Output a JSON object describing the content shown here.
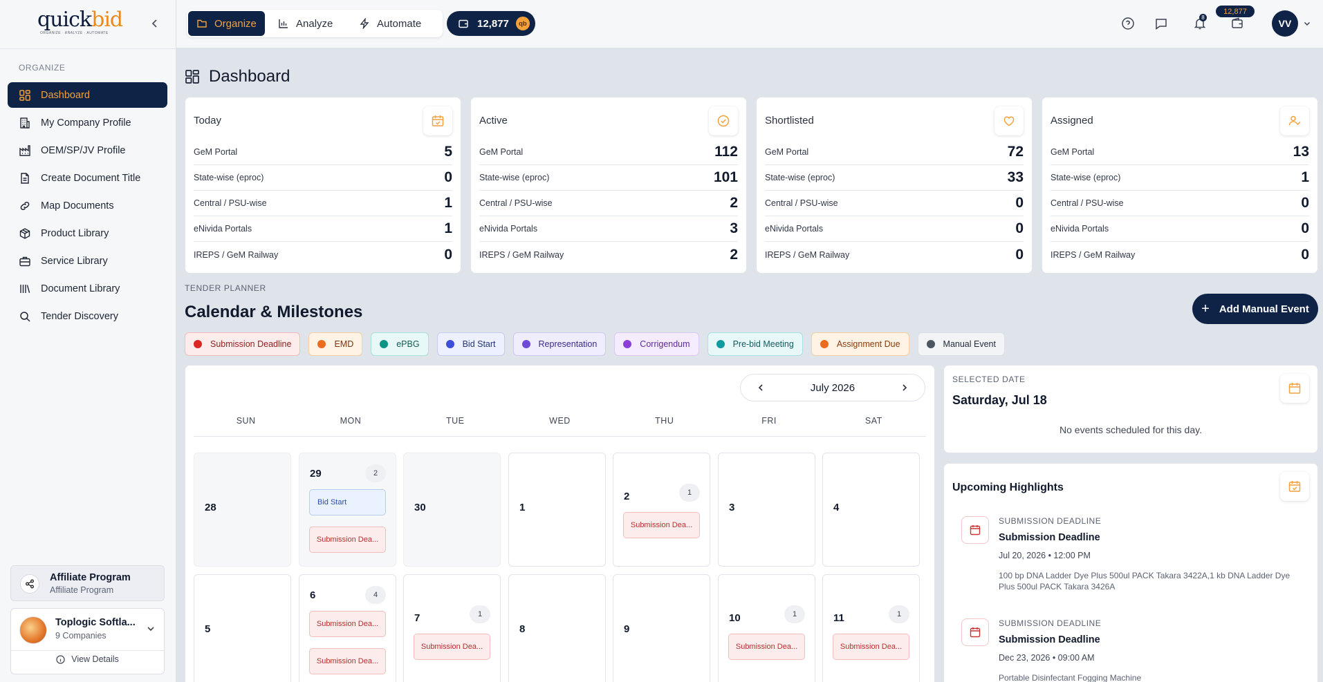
{
  "app": {
    "logo_main": "quick",
    "logo_accent": "bid",
    "logo_tagline": "ORGANIZE · ANALYZE · AUTOMATE"
  },
  "sidebar": {
    "section_label": "ORGANIZE",
    "items": [
      {
        "label": "Dashboard",
        "icon": "dashboard-icon",
        "active": true
      },
      {
        "label": "My Company Profile",
        "icon": "building-icon"
      },
      {
        "label": "OEM/SP/JV Profile",
        "icon": "factory-icon"
      },
      {
        "label": "Create Document Title",
        "icon": "document-icon"
      },
      {
        "label": "Map Documents",
        "icon": "link-icon"
      },
      {
        "label": "Product Library",
        "icon": "box-icon"
      },
      {
        "label": "Service Library",
        "icon": "briefcase-icon"
      },
      {
        "label": "Document Library",
        "icon": "library-icon"
      },
      {
        "label": "Tender Discovery",
        "icon": "search-icon"
      }
    ],
    "affiliate": {
      "title": "Affiliate Program",
      "subtitle": "Affiliate Program"
    },
    "company": {
      "name": "Toplogic Softla...",
      "subtitle": "9 Companies",
      "details_label": "View Details"
    }
  },
  "topbar": {
    "modes": [
      "Organize",
      "Analyze",
      "Automate"
    ],
    "active_mode": "Organize",
    "credits": "12,877",
    "credits_badge": "qb",
    "notification_count": "8",
    "wallet_value": "12,877",
    "avatar_initials": "VV"
  },
  "dashboard": {
    "title": "Dashboard",
    "cards": [
      {
        "title": "Today",
        "icon": "calendar-check-icon",
        "rows": [
          {
            "label": "GeM Portal",
            "value": "5"
          },
          {
            "label": "State-wise (eproc)",
            "value": "0"
          },
          {
            "label": "Central / PSU-wise",
            "value": "1"
          },
          {
            "label": "eNivida Portals",
            "value": "1"
          },
          {
            "label": "IREPS / GeM Railway",
            "value": "0"
          }
        ]
      },
      {
        "title": "Active",
        "icon": "check-circle-icon",
        "rows": [
          {
            "label": "GeM Portal",
            "value": "112"
          },
          {
            "label": "State-wise (eproc)",
            "value": "101"
          },
          {
            "label": "Central / PSU-wise",
            "value": "2"
          },
          {
            "label": "eNivida Portals",
            "value": "3"
          },
          {
            "label": "IREPS / GeM Railway",
            "value": "2"
          }
        ]
      },
      {
        "title": "Shortlisted",
        "icon": "heart-icon",
        "rows": [
          {
            "label": "GeM Portal",
            "value": "72"
          },
          {
            "label": "State-wise (eproc)",
            "value": "33"
          },
          {
            "label": "Central / PSU-wise",
            "value": "0"
          },
          {
            "label": "eNivida Portals",
            "value": "0"
          },
          {
            "label": "IREPS / GeM Railway",
            "value": "0"
          }
        ]
      },
      {
        "title": "Assigned",
        "icon": "user-check-icon",
        "rows": [
          {
            "label": "GeM Portal",
            "value": "13"
          },
          {
            "label": "State-wise (eproc)",
            "value": "1"
          },
          {
            "label": "Central / PSU-wise",
            "value": "0"
          },
          {
            "label": "eNivida Portals",
            "value": "0"
          },
          {
            "label": "IREPS / GeM Railway",
            "value": "0"
          }
        ]
      }
    ]
  },
  "planner": {
    "section_label": "TENDER PLANNER",
    "title": "Calendar & Milestones",
    "add_button": "Add Manual Event",
    "legend": [
      {
        "label": "Submission Deadline",
        "dot": "#dc2626",
        "bg": "#fdecec",
        "border": "#f3bcbc",
        "text": "#8f1d1d"
      },
      {
        "label": "EMD",
        "dot": "#ea6c1c",
        "bg": "#fff3e6",
        "border": "#f7cfa3",
        "text": "#7a3410"
      },
      {
        "label": "ePBG",
        "dot": "#0d9488",
        "bg": "#e8f8f6",
        "border": "#a8e2dc",
        "text": "#125c55"
      },
      {
        "label": "Bid Start",
        "dot": "#3b4fd8",
        "bg": "#ecf0ff",
        "border": "#c3cdf5",
        "text": "#23337a"
      },
      {
        "label": "Representation",
        "dot": "#6d4bd8",
        "bg": "#efedff",
        "border": "#cfc7f4",
        "text": "#3a2a8a"
      },
      {
        "label": "Corrigendum",
        "dot": "#8b3fd6",
        "bg": "#f5edff",
        "border": "#ddc7f5",
        "text": "#5e2a99"
      },
      {
        "label": "Pre-bid Meeting",
        "dot": "#0f9ba0",
        "bg": "#e8f8f8",
        "border": "#a9e0e2",
        "text": "#135a5e"
      },
      {
        "label": "Assignment Due",
        "dot": "#ea6c1c",
        "bg": "#fff3e6",
        "border": "#f7cfa3",
        "text": "#8a3a0c"
      },
      {
        "label": "Manual Event",
        "dot": "#4b5563",
        "bg": "#f3f4f6",
        "border": "#dde0e5",
        "text": "#1f2937"
      }
    ],
    "month": "July 2026",
    "weekdays": [
      "SUN",
      "MON",
      "TUE",
      "WED",
      "THU",
      "FRI",
      "SAT"
    ],
    "weeks": [
      [
        {
          "num": "28",
          "muted": true,
          "count": "",
          "events": []
        },
        {
          "num": "29",
          "muted": true,
          "count": "2",
          "events": [
            {
              "kind": "bid",
              "label": "Bid Start"
            },
            {
              "kind": "sub",
              "label": "Submission Dea..."
            }
          ]
        },
        {
          "num": "30",
          "muted": true,
          "count": "",
          "events": []
        },
        {
          "num": "1",
          "muted": false,
          "count": "",
          "events": []
        },
        {
          "num": "2",
          "muted": false,
          "count": "1",
          "events": [
            {
              "kind": "sub",
              "label": "Submission Dea..."
            }
          ]
        },
        {
          "num": "3",
          "muted": false,
          "count": "",
          "events": []
        },
        {
          "num": "4",
          "muted": false,
          "count": "",
          "events": []
        }
      ],
      [
        {
          "num": "5",
          "muted": false,
          "count": "",
          "events": []
        },
        {
          "num": "6",
          "muted": false,
          "count": "4",
          "events": [
            {
              "kind": "sub",
              "label": "Submission Dea..."
            },
            {
              "kind": "sub",
              "label": "Submission Dea..."
            }
          ]
        },
        {
          "num": "7",
          "muted": false,
          "count": "1",
          "events": [
            {
              "kind": "sub",
              "label": "Submission Dea..."
            }
          ]
        },
        {
          "num": "8",
          "muted": false,
          "count": "",
          "events": []
        },
        {
          "num": "9",
          "muted": false,
          "count": "",
          "events": []
        },
        {
          "num": "10",
          "muted": false,
          "count": "1",
          "events": [
            {
              "kind": "sub",
              "label": "Submission Dea..."
            }
          ]
        },
        {
          "num": "11",
          "muted": false,
          "count": "1",
          "events": [
            {
              "kind": "sub",
              "label": "Submission Dea..."
            }
          ]
        }
      ]
    ],
    "selected": {
      "label": "SELECTED DATE",
      "date": "Saturday, Jul 18",
      "empty": "No events scheduled for this day."
    },
    "upcoming": {
      "title": "Upcoming Highlights",
      "items": [
        {
          "type": "SUBMISSION DEADLINE",
          "title": "Submission Deadline",
          "time": "Jul 20, 2026 • 12:00 PM",
          "desc": "100 bp DNA Ladder Dye Plus 500ul PACK Takara 3422A,1 kb DNA Ladder Dye Plus 500ul PACK Takara 3426A"
        },
        {
          "type": "SUBMISSION DEADLINE",
          "title": "Submission Deadline",
          "time": "Dec 23, 2026 • 09:00 AM",
          "desc": "Portable Disinfectant Fogging Machine"
        }
      ]
    }
  }
}
